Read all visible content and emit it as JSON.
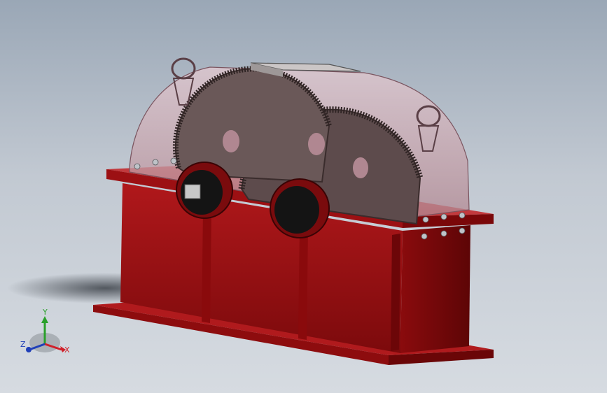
{
  "viewport": {
    "background_top": "#9aa7b6",
    "background_bottom": "#d6dbe1"
  },
  "model": {
    "housing_color": "#a10f12",
    "housing_dark": "#6e0708",
    "cover_color": "#c9a3ad",
    "gear_color": "#5e4c4c"
  },
  "triad": {
    "x_label": "X",
    "y_label": "Y",
    "z_label": "Z",
    "x_color": "#d0202a",
    "y_color": "#2aa02a",
    "z_color": "#1f3fb8"
  }
}
